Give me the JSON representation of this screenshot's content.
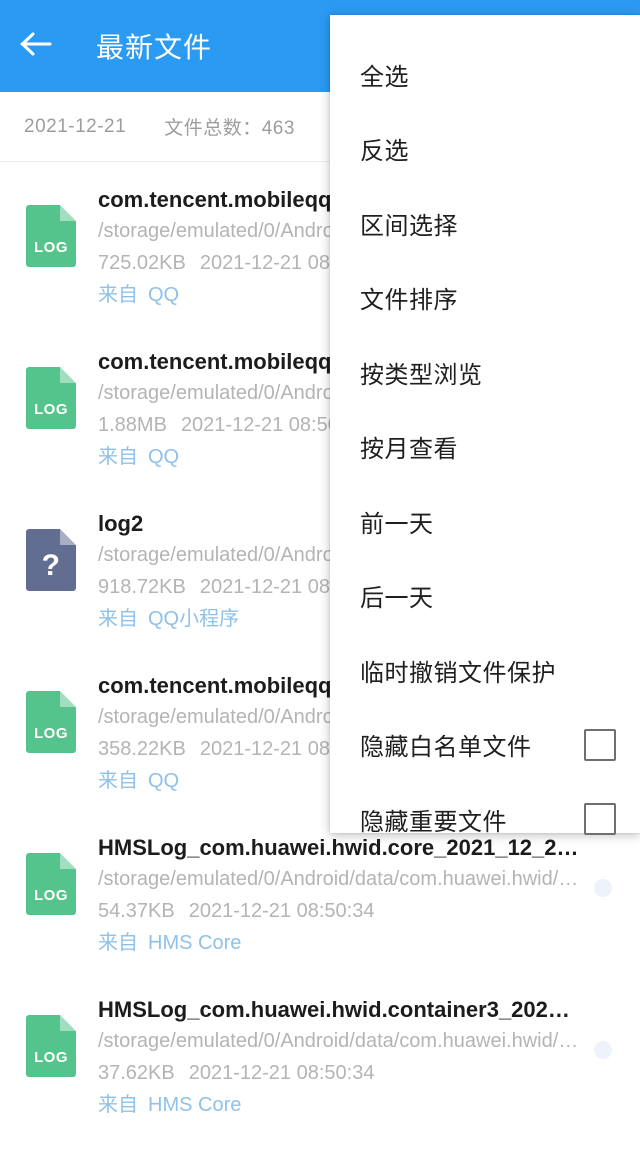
{
  "appbar": {
    "back_icon": "arrow-left-icon",
    "title": "最新文件",
    "background": "#2b9af3"
  },
  "infobar": {
    "date": "2021-12-21",
    "total_label": "文件总数：463"
  },
  "files": [
    {
      "icon_label": "LOG",
      "icon_kind": "log",
      "icon_color": "#55c48c",
      "name": "com.tencent.mobileqq...",
      "path": "/storage/emulated/0/Andro...",
      "size": "725.02KB",
      "date": "2021-12-21 08:5...",
      "from_label": "来自",
      "source": "QQ"
    },
    {
      "icon_label": "LOG",
      "icon_kind": "log",
      "icon_color": "#55c48c",
      "name": "com.tencent.mobileqq...",
      "path": "/storage/emulated/0/Andro...",
      "size": "1.88MB",
      "date": "2021-12-21 08:50...",
      "from_label": "来自",
      "source": "QQ"
    },
    {
      "icon_label": "?",
      "icon_kind": "unknown",
      "icon_color": "#616e91",
      "name": "log2",
      "path": "/storage/emulated/0/Andro...",
      "size": "918.72KB",
      "date": "2021-12-21 08:5...",
      "from_label": "来自",
      "source": "QQ小程序"
    },
    {
      "icon_label": "LOG",
      "icon_kind": "log",
      "icon_color": "#55c48c",
      "name": "com.tencent.mobileqq...",
      "path": "/storage/emulated/0/Andro...",
      "size": "358.22KB",
      "date": "2021-12-21 08:5...",
      "from_label": "来自",
      "source": "QQ"
    },
    {
      "icon_label": "LOG",
      "icon_kind": "log",
      "icon_color": "#55c48c",
      "name": "HMSLog_com.huawei.hwid.core_2021_12_2…",
      "path": "/storage/emulated/0/Android/data/com.huawei.hwid/…",
      "size": "54.37KB",
      "date": "2021-12-21 08:50:34",
      "from_label": "来自",
      "source": "HMS Core"
    },
    {
      "icon_label": "LOG",
      "icon_kind": "log",
      "icon_color": "#55c48c",
      "name": "HMSLog_com.huawei.hwid.container3_202…",
      "path": "/storage/emulated/0/Android/data/com.huawei.hwid/…",
      "size": "37.62KB",
      "date": "2021-12-21 08:50:34",
      "from_label": "来自",
      "source": "HMS Core"
    }
  ],
  "menu": {
    "items": [
      {
        "label": "全选",
        "checkbox": false,
        "checked": false
      },
      {
        "label": "反选",
        "checkbox": false,
        "checked": false
      },
      {
        "label": "区间选择",
        "checkbox": false,
        "checked": false
      },
      {
        "label": "文件排序",
        "checkbox": false,
        "checked": false
      },
      {
        "label": "按类型浏览",
        "checkbox": false,
        "checked": false
      },
      {
        "label": "按月查看",
        "checkbox": false,
        "checked": false
      },
      {
        "label": "前一天",
        "checkbox": false,
        "checked": false
      },
      {
        "label": "后一天",
        "checkbox": false,
        "checked": false
      },
      {
        "label": "临时撤销文件保护",
        "checkbox": false,
        "checked": false
      },
      {
        "label": "隐藏白名单文件",
        "checkbox": true,
        "checked": false
      },
      {
        "label": "隐藏重要文件",
        "checkbox": true,
        "checked": false
      }
    ]
  }
}
